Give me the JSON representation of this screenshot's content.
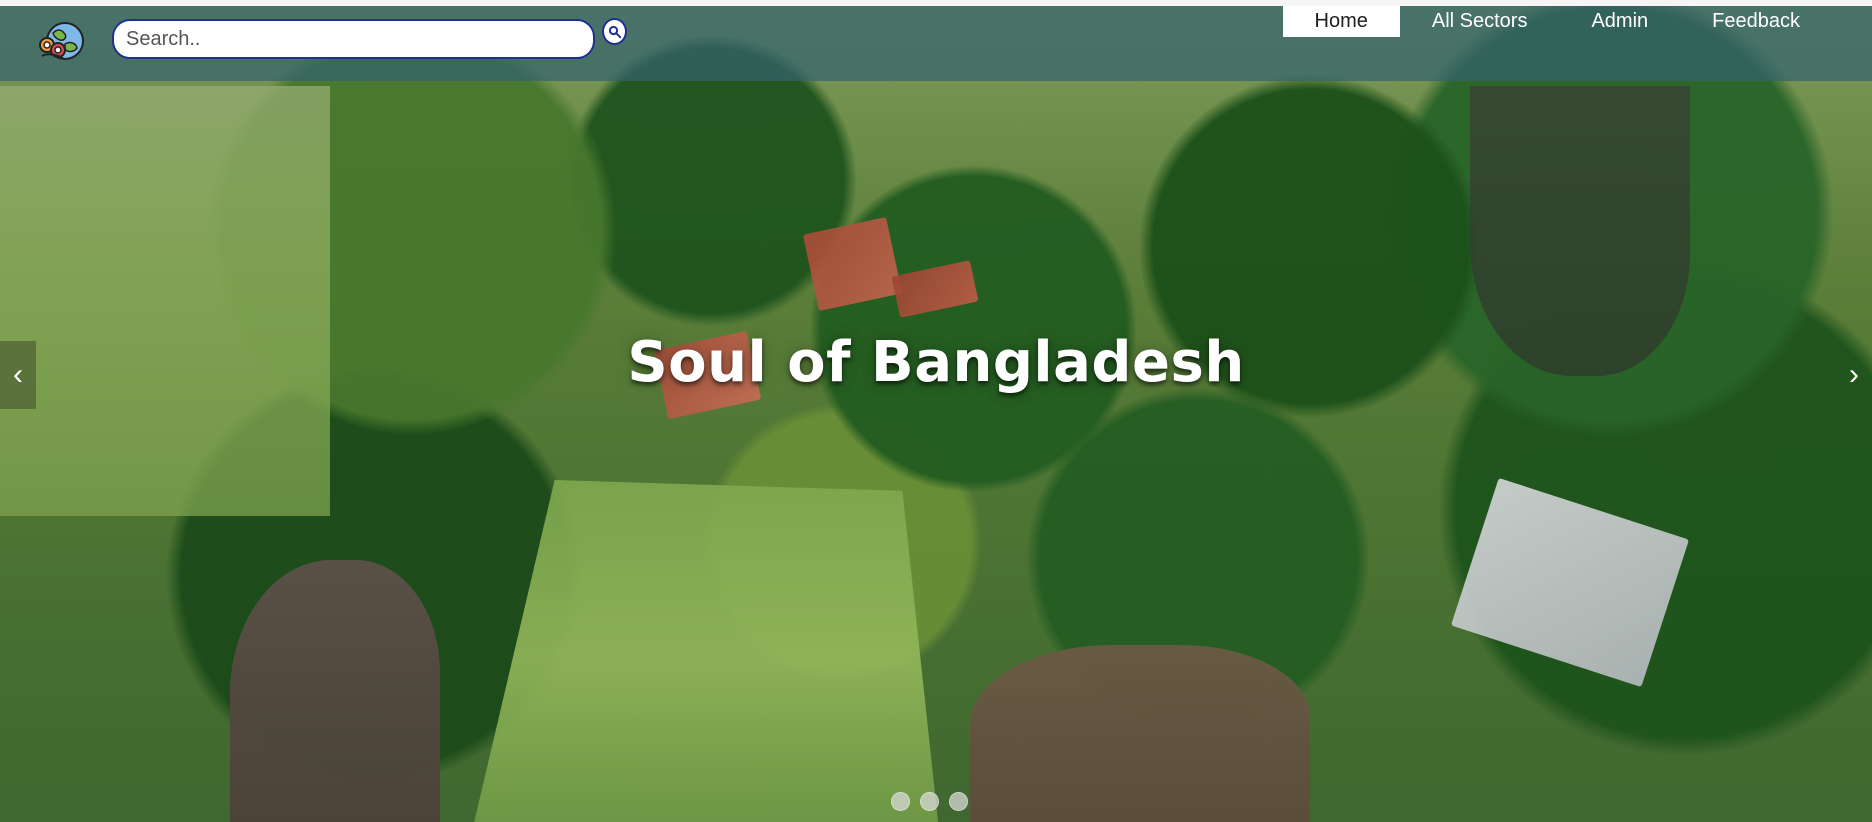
{
  "header": {
    "search": {
      "placeholder": "Search..",
      "value": ""
    },
    "nav": {
      "items": [
        {
          "label": "Home",
          "active": true
        },
        {
          "label": "All Sectors",
          "active": false
        },
        {
          "label": "Admin",
          "active": false
        },
        {
          "label": "Feedback",
          "active": false
        }
      ]
    }
  },
  "hero": {
    "title": "Soul of Bangladesh",
    "carousel": {
      "prev_icon": "‹",
      "next_icon": "›",
      "slides": 3,
      "active_slide": 1
    }
  },
  "icons": {
    "logo": "globe-logo",
    "search": "search-icon",
    "prev": "chevron-left-icon",
    "next": "chevron-right-icon"
  },
  "colors": {
    "topbar": "#34626E",
    "active_nav_bg": "#FFFFFF",
    "search_border": "#1F2F92",
    "hero_text": "#FFFFFF"
  }
}
